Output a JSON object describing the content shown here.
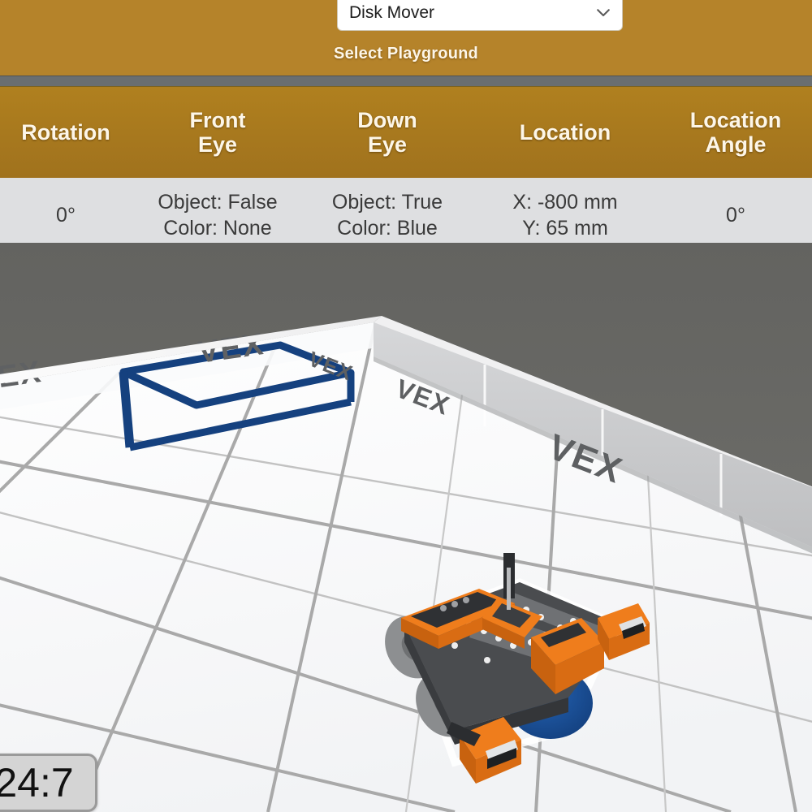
{
  "header": {
    "playground_select": {
      "value": "Disk Mover",
      "caret_icon": "chevron-down-icon",
      "options": [
        "Disk Mover"
      ]
    },
    "select_label": "Select Playground",
    "gold_color": "#b5832a"
  },
  "sensor_table": {
    "columns": [
      {
        "header": "Rotation"
      },
      {
        "header": "Front\nEye"
      },
      {
        "header": "Down\nEye"
      },
      {
        "header": "Location"
      },
      {
        "header": "Location\nAngle"
      }
    ],
    "headers": {
      "rotation": "Rotation",
      "front_eye_l1": "Front",
      "front_eye_l2": "Eye",
      "down_eye_l1": "Down",
      "down_eye_l2": "Eye",
      "location": "Location",
      "location_angle_l1": "Location",
      "location_angle_l2": "Angle"
    },
    "row": {
      "rotation": "0°",
      "front_eye_object": "Object: False",
      "front_eye_color": "Color: None",
      "down_eye_object": "Object: True",
      "down_eye_color": "Color: Blue",
      "location_x": "X: -800 mm",
      "location_y": "Y: 65 mm",
      "location_angle": "0°"
    },
    "header_bg": "#a8791f",
    "row_bg": "#dedfe1"
  },
  "viewport": {
    "background_color": "#6a6a66",
    "field": {
      "floor_color": "#fcfcfc",
      "grid_line_color": "#a9a9a9",
      "wall_color": "#c9cacc",
      "wall_logo_text": "VEX",
      "goal_zone_color": "#15417f",
      "wall_logos_count": 5,
      "floor_logos_count": 2
    },
    "robot": {
      "name": "vex-vr-robot",
      "body_color": "#3b3d40",
      "accent_color": "#ef7d1c",
      "wheel_color": "#8b8d8f",
      "carried_disk": {
        "name": "blue-disk",
        "color": "#17509b"
      }
    }
  },
  "timer": {
    "value": "24:7",
    "label": "match-timer"
  }
}
